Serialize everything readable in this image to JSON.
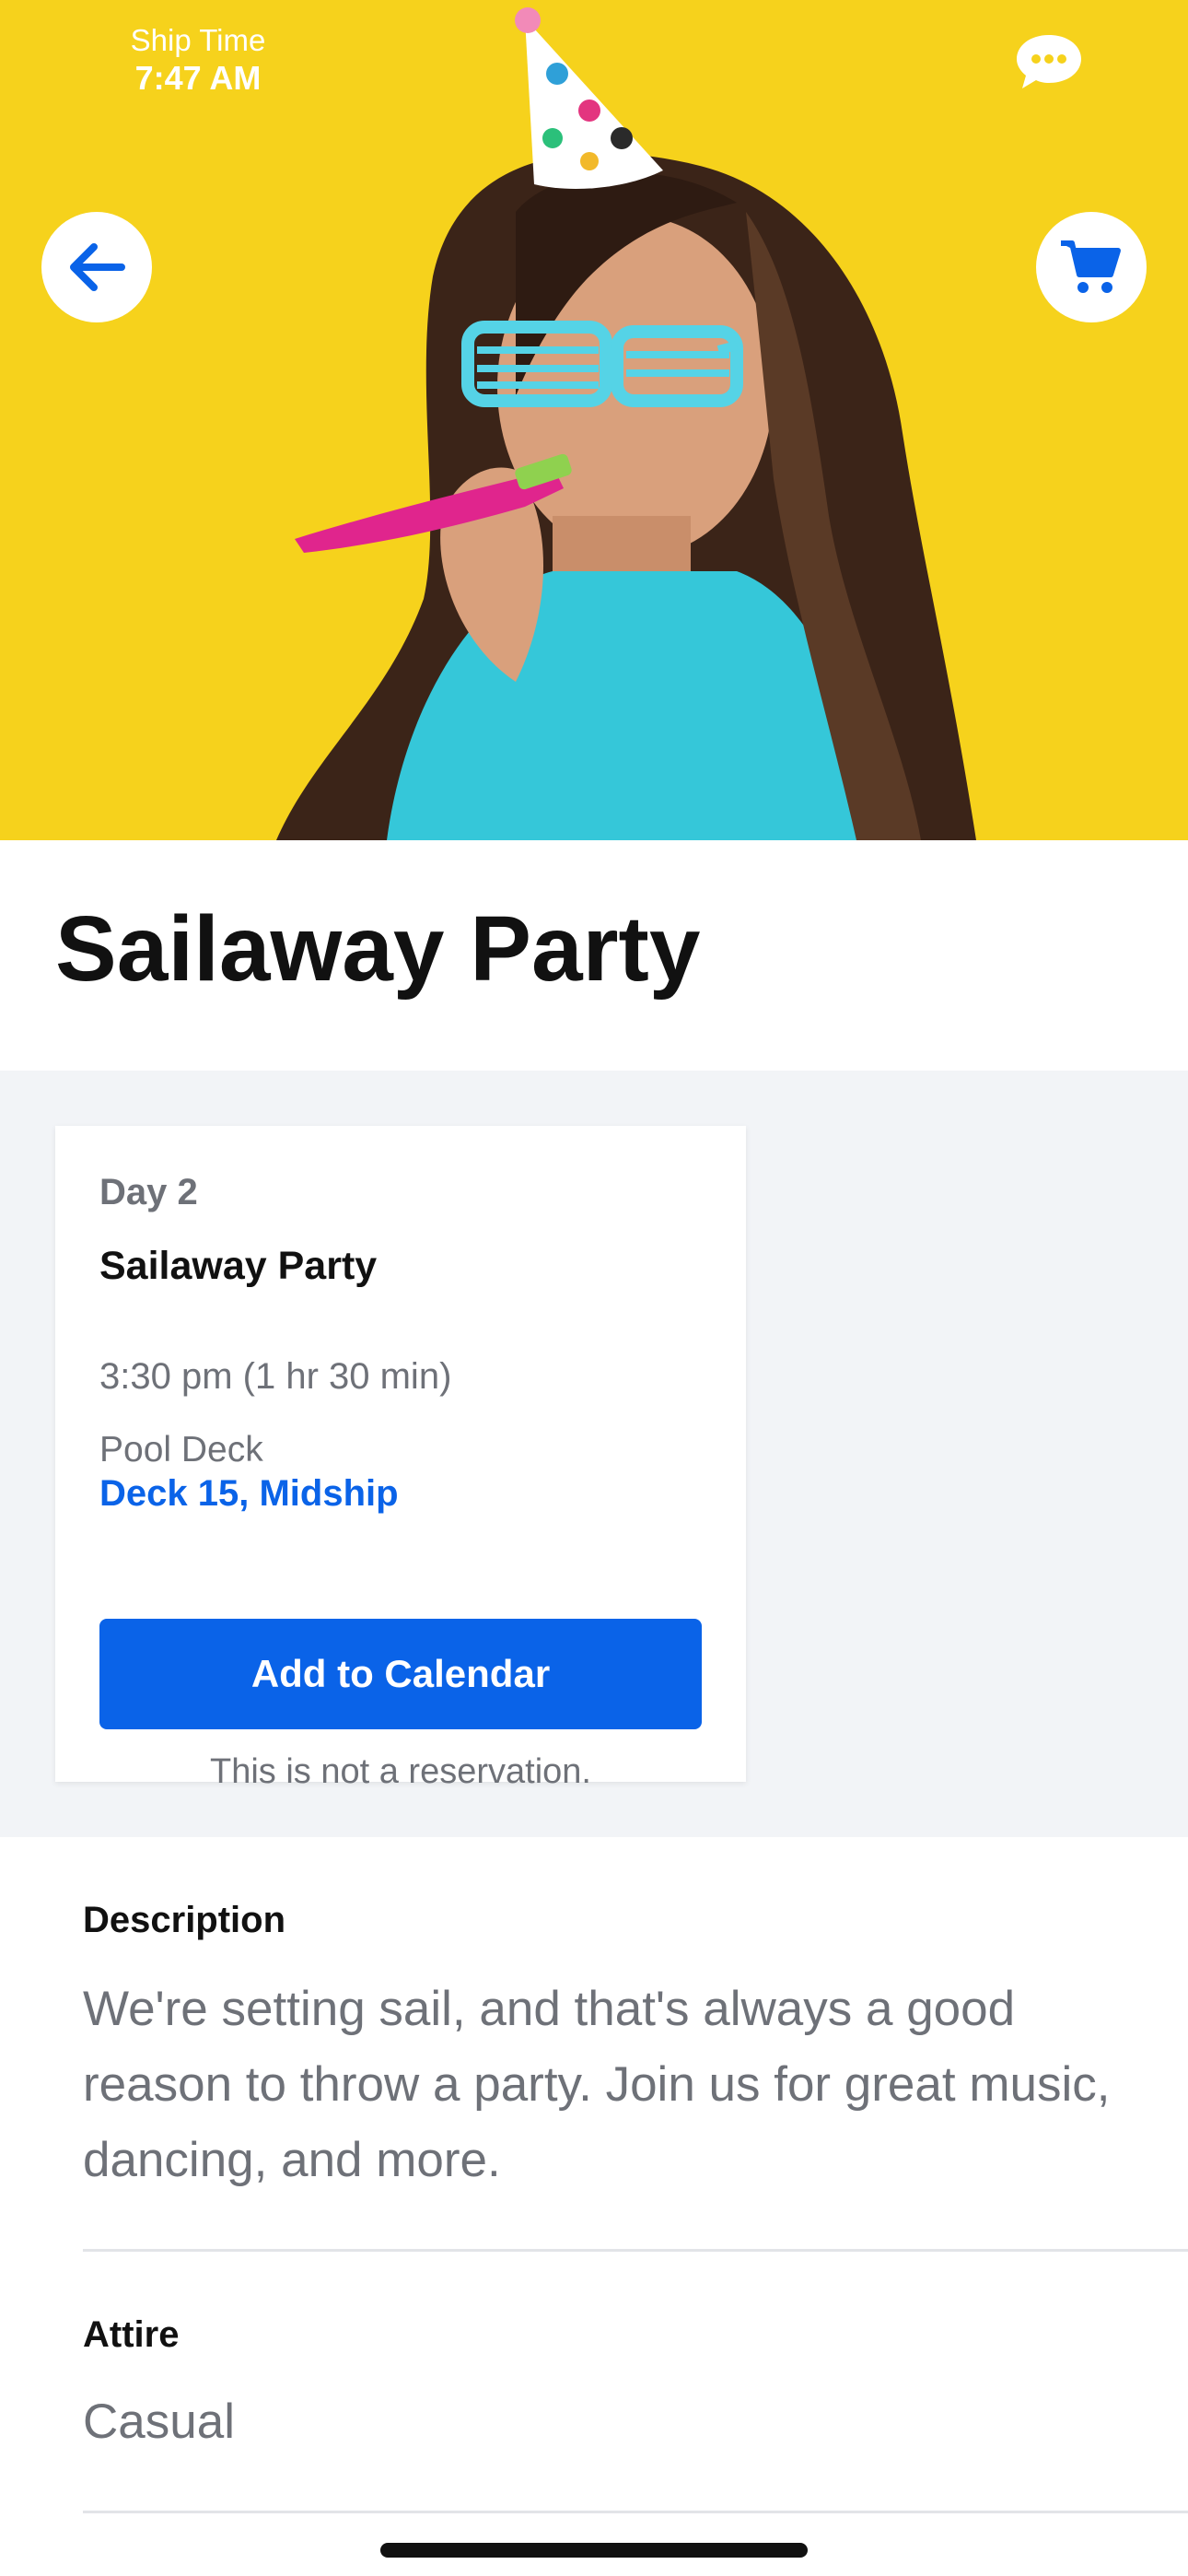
{
  "status": {
    "ship_time_label": "Ship Time",
    "ship_time_value": "7:47 AM"
  },
  "hero": {
    "back_icon": "arrow-left-icon",
    "cart_icon": "cart-icon",
    "chat_icon": "chat-bubble-icon"
  },
  "event": {
    "title": "Sailaway Party"
  },
  "card": {
    "day": "Day 2",
    "name": "Sailaway Party",
    "time": "3:30 pm (1 hr 30 min)",
    "venue": "Pool Deck",
    "deck": "Deck 15, Midship",
    "calendar_button": "Add to Calendar",
    "note": "This is not a reservation."
  },
  "description": {
    "label": "Description",
    "text": "We're setting sail, and that's always a good reason to throw a party. Join us for great music, dancing, and more."
  },
  "attire": {
    "label": "Attire",
    "value": "Casual"
  },
  "colors": {
    "accent": "#0a63e8",
    "hero_bg": "#f6d21c",
    "section_bg": "#f2f4f7"
  }
}
